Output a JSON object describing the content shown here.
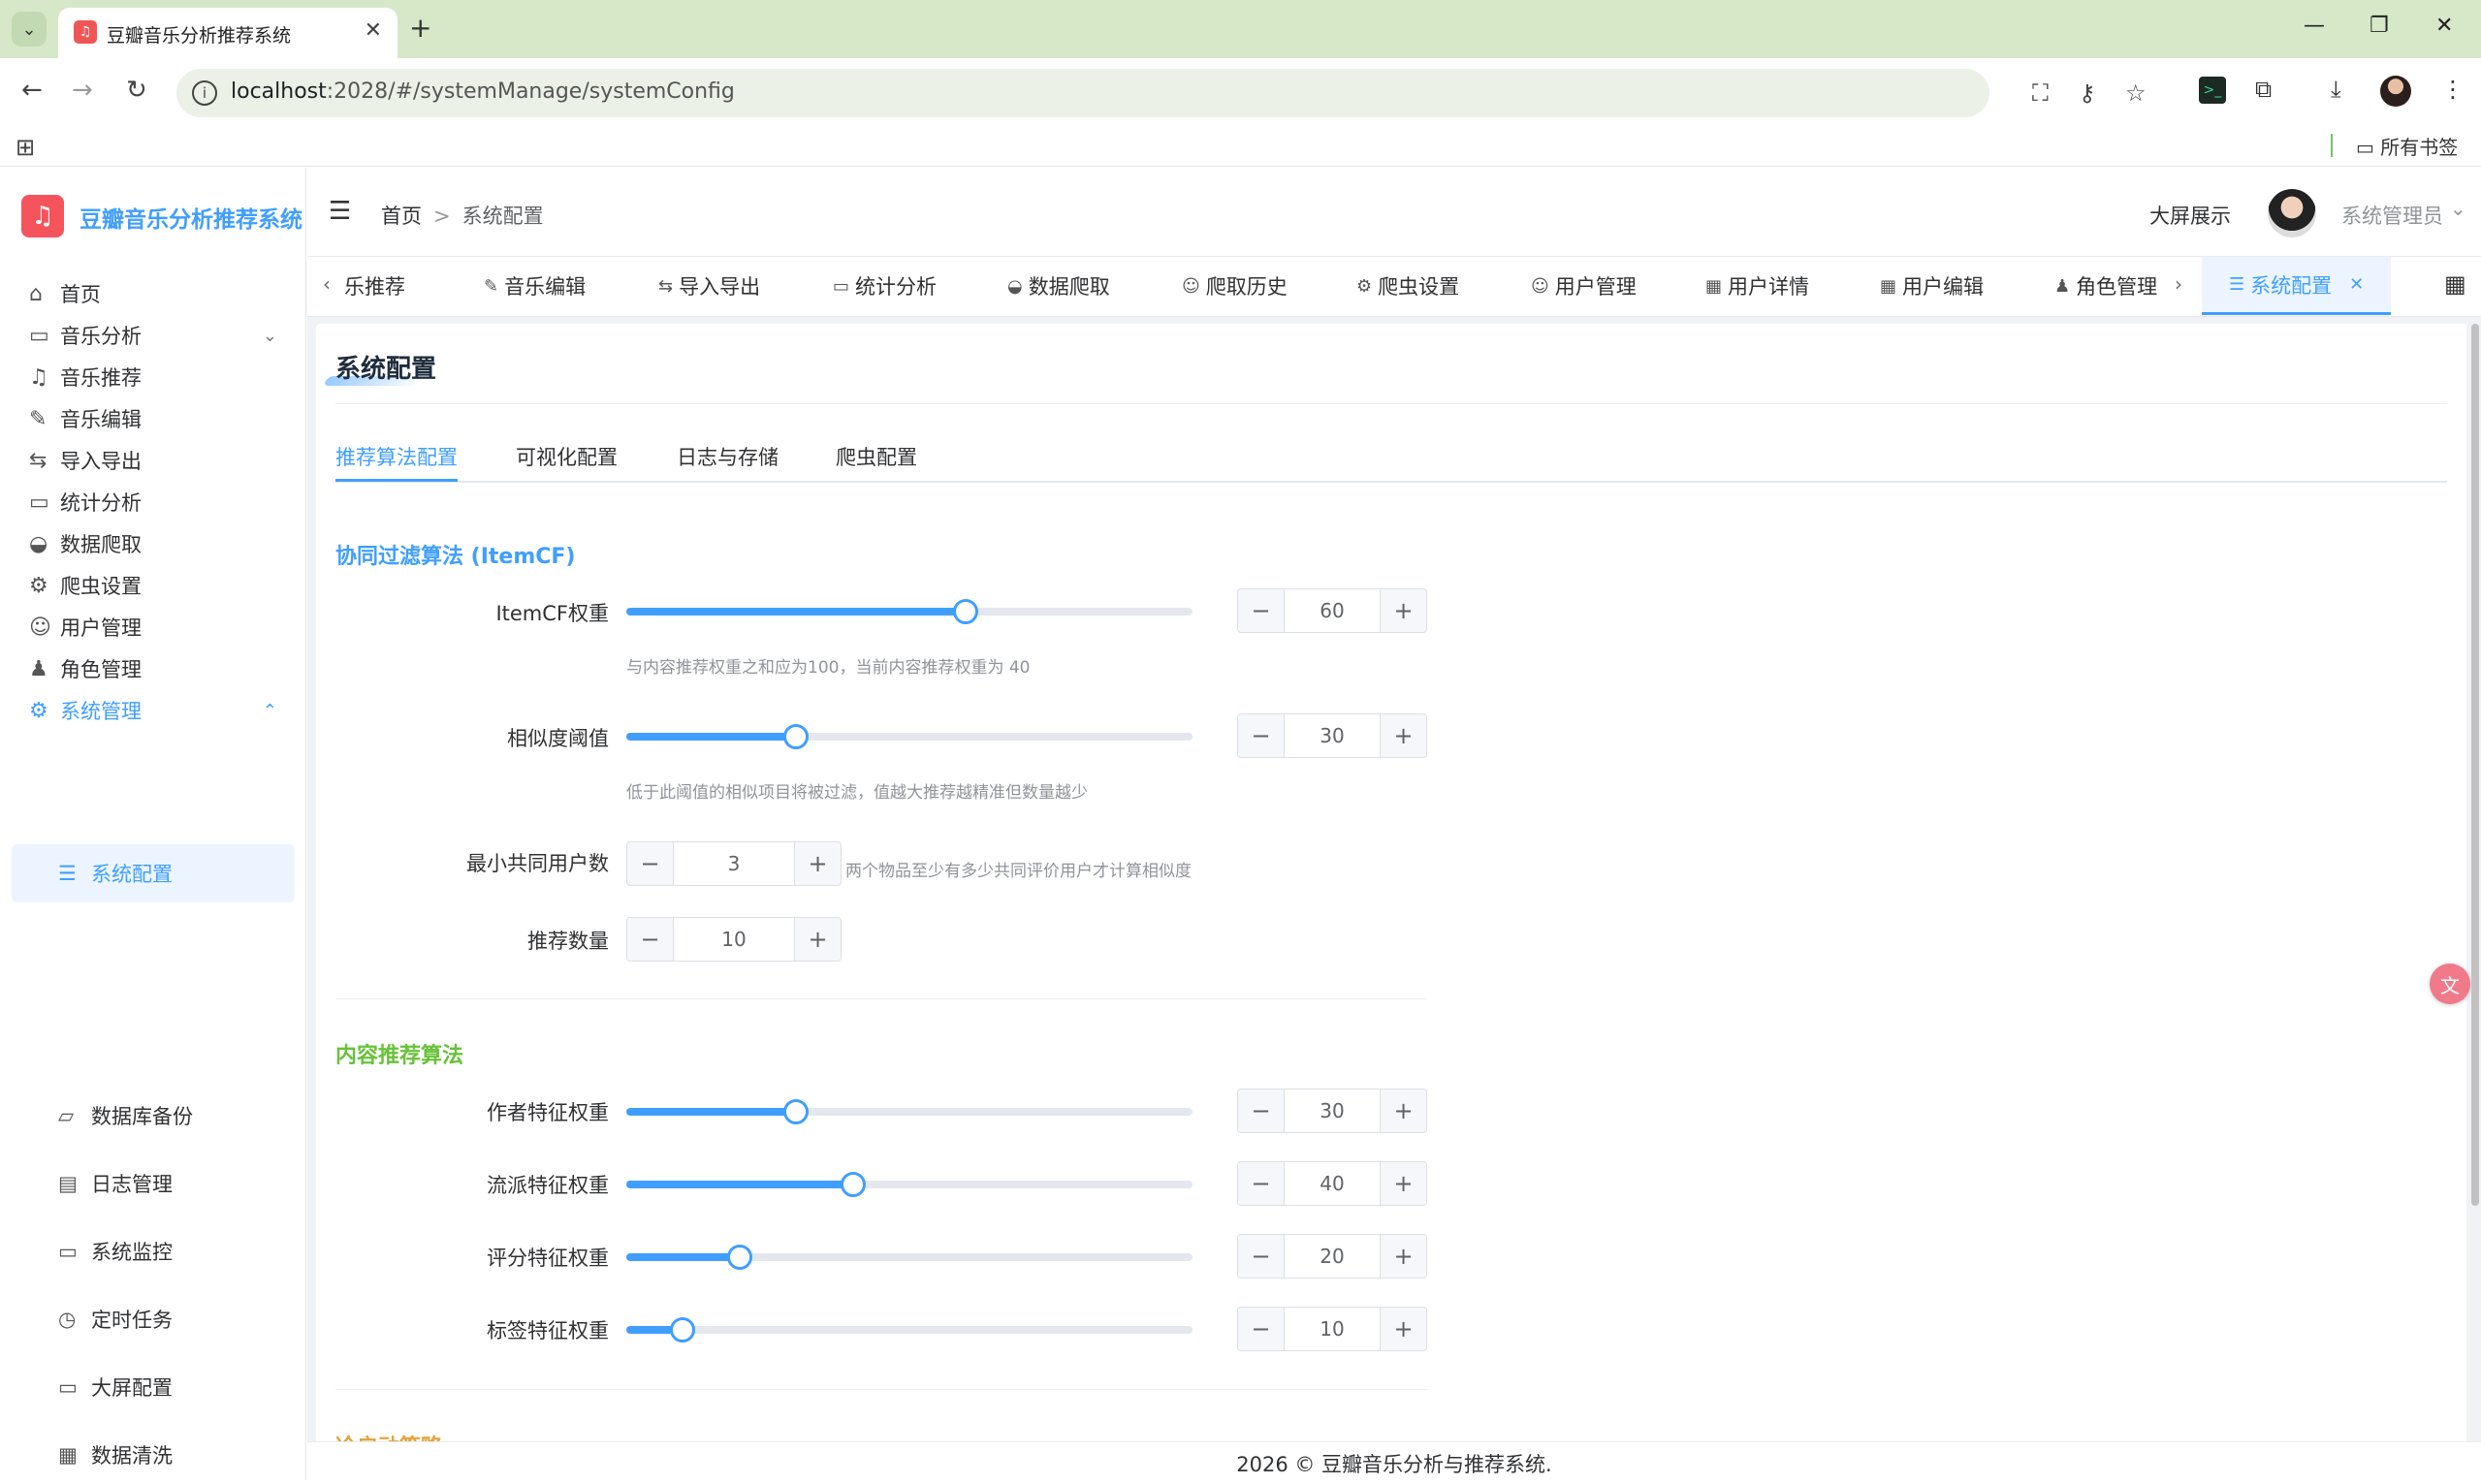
{
  "browser": {
    "tab_title": "豆瓣音乐分析推荐系统",
    "tab_close": "✕",
    "new_tab": "+",
    "url_host": "localhost",
    "url_rest": ":2028/#/systemManage/systemConfig",
    "bookmark_folder": "所有书签",
    "window_controls": [
      "—",
      "❐",
      "✕"
    ]
  },
  "app": {
    "logo_text": "豆瓣音乐分析推荐系统",
    "header": {
      "breadcrumb_home": "首页",
      "breadcrumb_sep": ">",
      "breadcrumb_current": "系统配置",
      "big_screen": "大屏展示",
      "user_name": "系统管理员"
    },
    "sidebar": {
      "items": [
        {
          "label": "首页",
          "icon": "home-icon",
          "glyph": "⌂"
        },
        {
          "label": "音乐分析",
          "icon": "presentation-icon",
          "glyph": "▭",
          "arrow": "⌄"
        },
        {
          "label": "音乐推荐",
          "icon": "headphones-icon",
          "glyph": "♫"
        },
        {
          "label": "音乐编辑",
          "icon": "edit-icon",
          "glyph": "✎"
        },
        {
          "label": "导入导出",
          "icon": "transfer-icon",
          "glyph": "⇆"
        },
        {
          "label": "统计分析",
          "icon": "presentation-icon",
          "glyph": "▭"
        },
        {
          "label": "数据爬取",
          "icon": "bowl-icon",
          "glyph": "◒"
        },
        {
          "label": "爬虫设置",
          "icon": "gear-icon",
          "glyph": "⚙"
        },
        {
          "label": "用户管理",
          "icon": "user-icon",
          "glyph": "☺"
        },
        {
          "label": "角色管理",
          "icon": "avatar-icon",
          "glyph": "♟"
        },
        {
          "label": "系统管理",
          "icon": "gear-icon",
          "glyph": "⚙",
          "arrow": "⌃"
        }
      ],
      "sub_items": [
        {
          "label": "系统配置",
          "icon": "sliders-icon",
          "glyph": "☰"
        },
        {
          "label": "数据库备份",
          "icon": "folder-icon",
          "glyph": "▱"
        },
        {
          "label": "日志管理",
          "icon": "document-icon",
          "glyph": "▤"
        },
        {
          "label": "系统监控",
          "icon": "monitor-icon",
          "glyph": "▭"
        },
        {
          "label": "定时任务",
          "icon": "timer-icon",
          "glyph": "◷"
        },
        {
          "label": "大屏配置",
          "icon": "presentation-icon",
          "glyph": "▭"
        },
        {
          "label": "数据清洗",
          "icon": "printer-icon",
          "glyph": "▦"
        }
      ]
    },
    "tags": [
      {
        "label": "乐推荐",
        "icon": "",
        "glyph": ""
      },
      {
        "label": "音乐编辑",
        "icon": "edit-icon",
        "glyph": "✎"
      },
      {
        "label": "导入导出",
        "icon": "transfer-icon",
        "glyph": "⇆"
      },
      {
        "label": "统计分析",
        "icon": "presentation-icon",
        "glyph": "▭"
      },
      {
        "label": "数据爬取",
        "icon": "bowl-icon",
        "glyph": "◒"
      },
      {
        "label": "爬取历史",
        "icon": "user-icon",
        "glyph": "☺"
      },
      {
        "label": "爬虫设置",
        "icon": "gear-icon",
        "glyph": "⚙"
      },
      {
        "label": "用户管理",
        "icon": "user-icon",
        "glyph": "☺"
      },
      {
        "label": "用户详情",
        "icon": "grid-icon",
        "glyph": "▦"
      },
      {
        "label": "用户编辑",
        "icon": "grid-icon",
        "glyph": "▦"
      },
      {
        "label": "角色管理",
        "icon": "avatar-icon",
        "glyph": "♟"
      },
      {
        "label": "系统配置",
        "icon": "sliders-icon",
        "glyph": "☰",
        "close": "✕"
      }
    ],
    "page": {
      "title": "系统配置",
      "settings_tabs": [
        "推荐算法配置",
        "可视化配置",
        "日志与存储",
        "爬虫配置"
      ],
      "itemcf": {
        "title": "协同过滤算法 (ItemCF)",
        "title_color": "#409eff",
        "weight_label": "ItemCF权重",
        "weight_value": 60,
        "weight_hint": "与内容推荐权重之和应为100，当前内容推荐权重为 40",
        "threshold_label": "相似度阈值",
        "threshold_value": 30,
        "threshold_hint": "低于此阈值的相似项目将被过滤，值越大推荐越精准但数量越少",
        "min_users_label": "最小共同用户数",
        "min_users_value": 3,
        "min_users_hint": "两个物品至少有多少共同评价用户才计算相似度",
        "rec_count_label": "推荐数量",
        "rec_count_value": 10
      },
      "content": {
        "title": "内容推荐算法",
        "title_color": "#67c23a",
        "author_label": "作者特征权重",
        "author_value": 30,
        "genre_label": "流派特征权重",
        "genre_value": 40,
        "rating_label": "评分特征权重",
        "rating_value": 20,
        "tag_label": "标签特征权重",
        "tag_value": 10
      },
      "cold_start": {
        "title": "冷启动策略",
        "title_color": "#e6a23c"
      }
    },
    "stepper_minus": "−",
    "stepper_plus": "+",
    "footer": "2026 © 豆瓣音乐分析与推荐系统."
  },
  "colors": {
    "accent": "#409eff",
    "logo_bg": "#f5545c",
    "chrome_bg": "#d6e8c8"
  }
}
